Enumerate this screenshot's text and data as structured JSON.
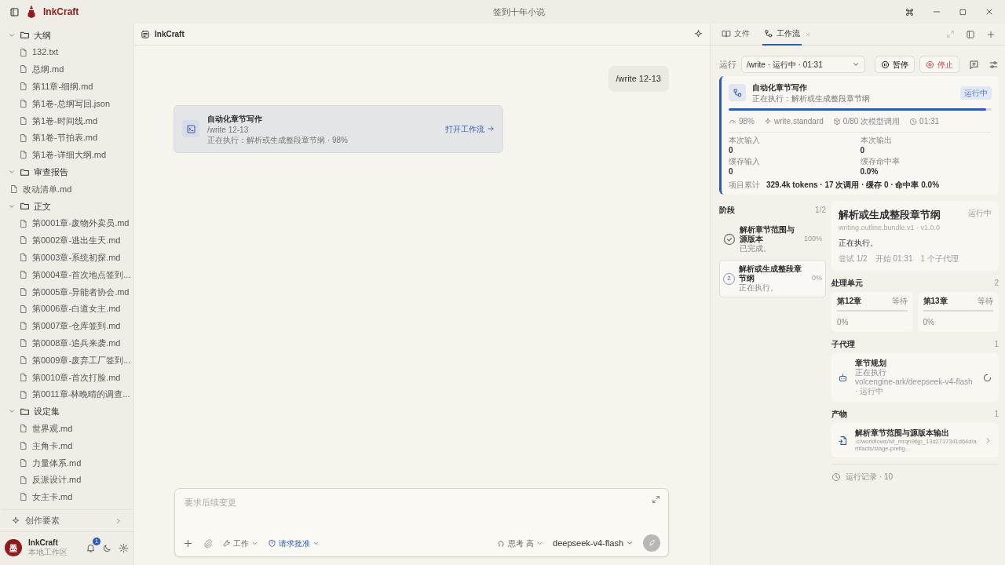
{
  "app": {
    "name": "InkCraft"
  },
  "window": {
    "title": "签到十年小说"
  },
  "file_tree": [
    {
      "label": "大纲",
      "kind": "folder",
      "expanded": true,
      "children": [
        {
          "label": "132.txt",
          "kind": "file"
        },
        {
          "label": "总纲.md",
          "kind": "file"
        },
        {
          "label": "第11章-细纲.md",
          "kind": "file"
        },
        {
          "label": "第1卷-总纲写回.json",
          "kind": "file"
        },
        {
          "label": "第1卷-时间线.md",
          "kind": "file"
        },
        {
          "label": "第1卷-节拍表.md",
          "kind": "file"
        },
        {
          "label": "第1卷-详细大纲.md",
          "kind": "file"
        }
      ]
    },
    {
      "label": "审查报告",
      "kind": "folder",
      "expanded": true
    },
    {
      "label": "改动清单.md",
      "kind": "file"
    },
    {
      "label": "正文",
      "kind": "folder",
      "expanded": true,
      "children": [
        {
          "label": "第0001章-废物外卖员.md",
          "kind": "file"
        },
        {
          "label": "第0002章-逃出生天.md",
          "kind": "file"
        },
        {
          "label": "第0003章-系统初探.md",
          "kind": "file"
        },
        {
          "label": "第0004章-首次地点签到...",
          "kind": "file"
        },
        {
          "label": "第0005章-异能者协会.md",
          "kind": "file"
        },
        {
          "label": "第0006章-白道女主.md",
          "kind": "file"
        },
        {
          "label": "第0007章-仓库签到.md",
          "kind": "file"
        },
        {
          "label": "第0008章-追兵来袭.md",
          "kind": "file"
        },
        {
          "label": "第0009章-废弃工厂签到...",
          "kind": "file"
        },
        {
          "label": "第0010章-首次打脸.md",
          "kind": "file"
        },
        {
          "label": "第0011章-林晚晴的调查...",
          "kind": "file"
        }
      ]
    },
    {
      "label": "设定集",
      "kind": "folder",
      "expanded": true,
      "children": [
        {
          "label": "世界观.md",
          "kind": "file"
        },
        {
          "label": "主角卡.md",
          "kind": "file"
        },
        {
          "label": "力量体系.md",
          "kind": "file"
        },
        {
          "label": "反派设计.md",
          "kind": "file"
        },
        {
          "label": "女主卡.md",
          "kind": "file"
        }
      ]
    }
  ],
  "sidebar_footer": {
    "elements_link": "创作要素",
    "avatar_text": "墨",
    "user_name": "InkCraft",
    "workspace": "本地工作区",
    "notifications": "1"
  },
  "chat": {
    "title": "InkCraft",
    "messages": [
      {
        "kind": "user",
        "text": "/write 12-13"
      },
      {
        "kind": "workflow",
        "title": "自动化章节写作",
        "command": "/write 12-13",
        "status": "正在执行：解析或生成整段章节纲 · 98%",
        "link": "打开工作流"
      }
    ]
  },
  "composer": {
    "placeholder": "要求后续变更",
    "mode": "工作",
    "approval": "请求批准",
    "thinking": "思考 高",
    "model": "deepseek-v4-flash"
  },
  "panel": {
    "tabs": [
      {
        "label": "文件",
        "kind": "files",
        "selected": false
      },
      {
        "label": "工作流",
        "kind": "workflow",
        "selected": true
      }
    ],
    "run": {
      "label": "运行",
      "value": "/write · 运行中 · 01:31",
      "pause": "暂停",
      "stop": "停止"
    },
    "summary": {
      "title": "自动化章节写作",
      "subtitle": "正在执行：解析或生成整段章节纲",
      "badge": "运行中",
      "level": 0.98,
      "stats": [
        {
          "kind": "progress",
          "text": "98%"
        },
        {
          "kind": "preset",
          "text": "write.standard"
        },
        {
          "kind": "calls",
          "text": "0/80 次模型调用"
        },
        {
          "kind": "time",
          "text": "01:31"
        }
      ],
      "metrics": [
        {
          "label": "本次输入",
          "value": "0"
        },
        {
          "label": "本次输出",
          "value": "0"
        },
        {
          "label": "缓存输入",
          "value": "0"
        },
        {
          "label": "缓存命中率",
          "value": "0.0%"
        }
      ],
      "total_label": "项目累计",
      "total": "329.4k tokens · 17 次调用 · 缓存 0 · 命中率 0.0%"
    },
    "stages": {
      "title": "阶段",
      "count": "1/2",
      "items": [
        {
          "title": "解析章节范围与源版本",
          "status": "已完成。",
          "percent": "100%",
          "done": true,
          "selected": false
        },
        {
          "number": "2",
          "title": "解析或生成整段章节纲",
          "status": "正在执行。",
          "percent": "0%",
          "done": false,
          "selected": true
        }
      ]
    },
    "stage_detail": {
      "title": "解析或生成整段章节纲",
      "badge": "运行中",
      "id": "writing.outline.bundle.v1 · v1.0.0",
      "message": "正在执行。",
      "meta": [
        "尝试 1/2",
        "开始 01:31",
        "1 个子代理"
      ]
    },
    "units": {
      "title": "处理单元",
      "count": "2",
      "items": [
        {
          "name": "第12章",
          "state": "等待",
          "level": 0,
          "percent": "0%"
        },
        {
          "name": "第13章",
          "state": "等待",
          "level": 0,
          "percent": "0%"
        }
      ]
    },
    "subagents": {
      "title": "子代理",
      "count": "1",
      "items": [
        {
          "name": "章节规划",
          "status": "正在执行",
          "detail": "volcengine-ark/deepseek-v4-flash · 运行中"
        }
      ]
    },
    "artifacts": {
      "title": "产物",
      "count": "1",
      "items": [
        {
          "name": "解析章节范围与源版本输出",
          "path": ".c/workflows/wf_mrqn96jp_13d2717341d64d/artifacts/stage-prefig..."
        }
      ]
    },
    "history": "运行记录 · 10"
  }
}
